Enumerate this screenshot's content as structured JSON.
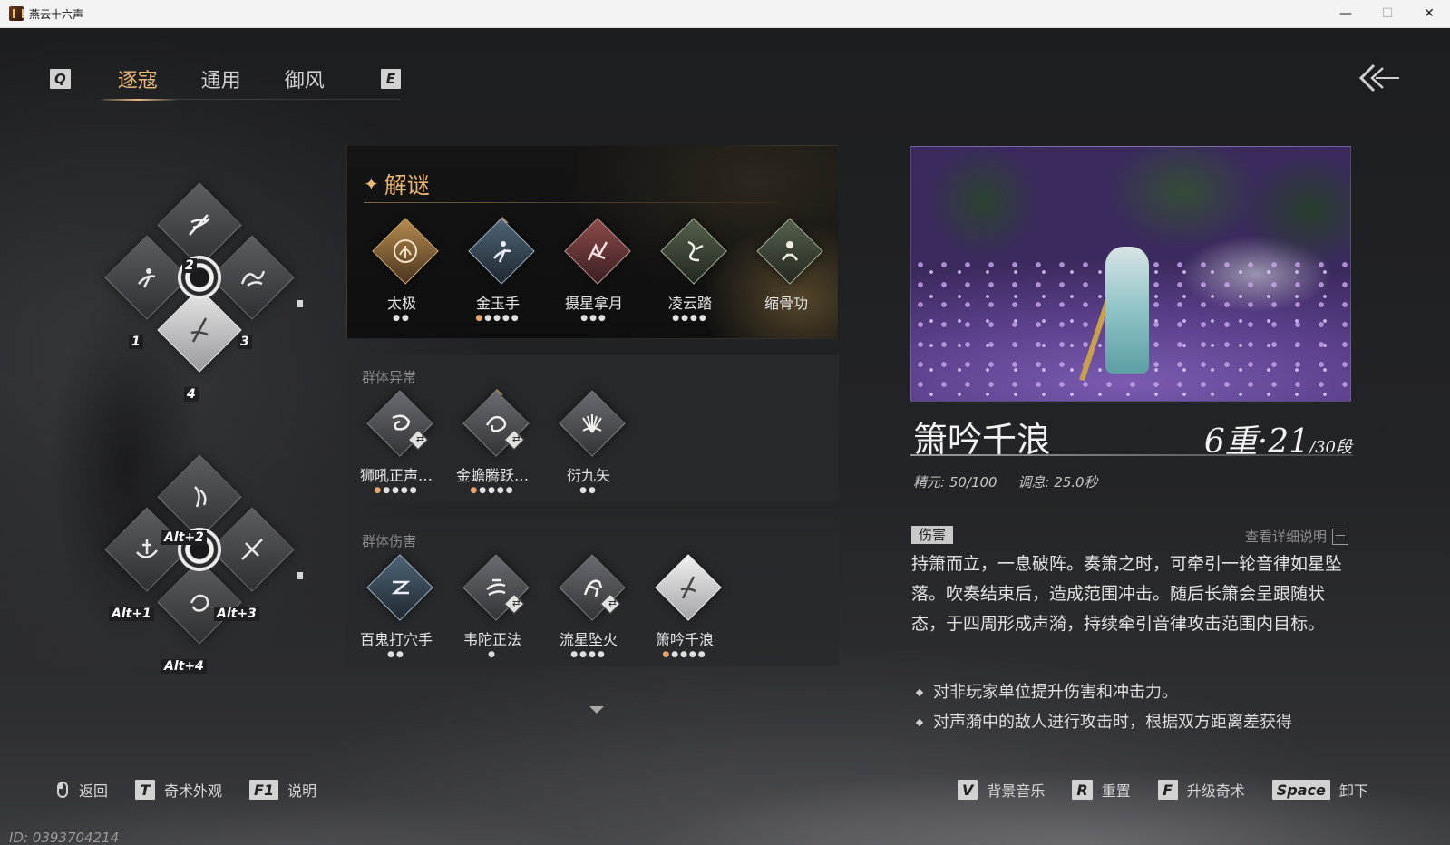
{
  "window": {
    "title": "燕云十六声",
    "minimize": "—",
    "maximize": "☐",
    "close": "✕"
  },
  "tabs": {
    "prev_key": "Q",
    "next_key": "E",
    "items": [
      {
        "label": "逐寇",
        "active": true
      },
      {
        "label": "通用",
        "active": false
      },
      {
        "label": "御风",
        "active": false
      }
    ]
  },
  "wheels": {
    "primary": {
      "slots": [
        "1",
        "2",
        "3",
        "4"
      ]
    },
    "alt": {
      "slots": [
        "Alt+1",
        "Alt+2",
        "Alt+3",
        "Alt+4"
      ]
    }
  },
  "sections": {
    "puzzle": {
      "title": "解谜",
      "skills": [
        {
          "name": "太极",
          "dots_on": 0,
          "dots_total": 2,
          "tone": "gold"
        },
        {
          "name": "金玉手",
          "dots_on": 1,
          "dots_total": 5,
          "tone": "blue"
        },
        {
          "name": "摄星拿月",
          "dots_on": 0,
          "dots_total": 3,
          "tone": "red"
        },
        {
          "name": "凌云踏",
          "dots_on": 0,
          "dots_total": 4,
          "tone": "green"
        },
        {
          "name": "缩骨功",
          "dots_on": 0,
          "dots_total": 0,
          "tone": "green"
        }
      ]
    },
    "abnormal": {
      "title": "群体异常",
      "skills": [
        {
          "name": "狮吼正声…",
          "dots_on": 1,
          "dots_total": 5
        },
        {
          "name": "金蟾腾跃…",
          "dots_on": 1,
          "dots_total": 5
        },
        {
          "name": "衍九矢",
          "dots_on": 0,
          "dots_total": 2
        }
      ]
    },
    "damage": {
      "title": "群体伤害",
      "skills": [
        {
          "name": "百鬼打穴手",
          "dots_on": 0,
          "dots_total": 2
        },
        {
          "name": "韦陀正法",
          "dots_on": 0,
          "dots_total": 1
        },
        {
          "name": "流星坠火",
          "dots_on": 0,
          "dots_total": 4
        },
        {
          "name": "箫吟千浪",
          "dots_on": 1,
          "dots_total": 5
        }
      ]
    }
  },
  "detail": {
    "name": "箫吟千浪",
    "level_main": "6重·21",
    "level_total": "/30段",
    "stats": {
      "energy": "精元: 50/100",
      "cooldown": "调息: 25.0秒"
    },
    "tag": "伤害",
    "details_link": "查看详细说明",
    "description": "持箫而立，一息破阵。奏箫之时，可牵引一轮音律如星坠落。吹奏结束后，造成范围冲击。随后长箫会呈跟随状态，于四周形成声漪，持续牵引音律攻击范围内目标。",
    "bullets": [
      "对非玩家单位提升伤害和冲击力。",
      "对声漪中的敌人进行攻击时，根据双方距离差获得"
    ]
  },
  "hints": {
    "left": [
      {
        "key": "",
        "label": "返回"
      },
      {
        "key": "T",
        "label": "奇术外观"
      },
      {
        "key": "F1",
        "label": "说明"
      }
    ],
    "right": [
      {
        "key": "V",
        "label": "背景音乐"
      },
      {
        "key": "R",
        "label": "重置"
      },
      {
        "key": "F",
        "label": "升级奇术"
      },
      {
        "key": "Space",
        "label": "卸下"
      }
    ]
  },
  "player_id": "ID: 0393704214"
}
